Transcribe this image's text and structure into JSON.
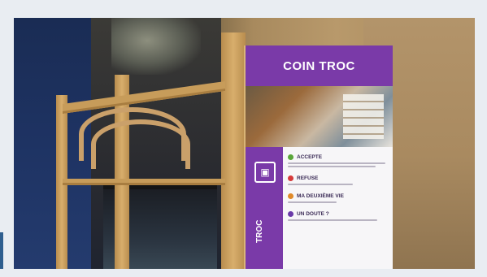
{
  "image": {
    "sign": {
      "title": "COIN TROC",
      "side_label": "TROC",
      "side_icon": "recycle-box-icon",
      "items": [
        {
          "title": "ACCEPTE",
          "color": "#5aa63a"
        },
        {
          "title": "REFUSE",
          "color": "#d63a3a"
        },
        {
          "title": "MA DEUXIÈME VIE",
          "color": "#e08a2a"
        },
        {
          "title": "UN DOUTE ?",
          "color": "#6a3aa8"
        }
      ]
    },
    "colors": {
      "accent": "#7a3aa8",
      "frame_border": "#e9edf2",
      "wood": "#c79c5a"
    }
  }
}
